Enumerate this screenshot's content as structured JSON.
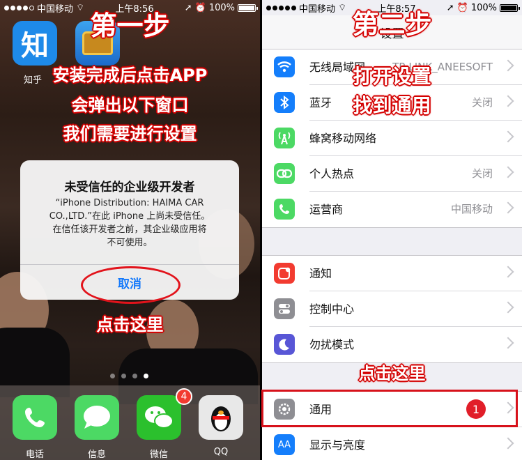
{
  "left": {
    "status": {
      "carrier": "中国移动",
      "time": "上午8:56",
      "battery": "100%"
    },
    "apps": [
      {
        "name": "知乎",
        "glyph": "知"
      }
    ],
    "overlay": {
      "step": "第一步",
      "line1": "安装完成后点击APP",
      "line2": "会弹出以下窗口",
      "line3": "我们需要进行设置",
      "click_here": "点击这里"
    },
    "alert": {
      "title": "未受信任的企业级开发者",
      "body_line1": "“iPhone Distribution: HAIMA CAR",
      "body_line2": "CO.,LTD.”在此 iPhone 上尚未受信任。",
      "body_line3": "在信任该开发者之前，其企业级应用将",
      "body_line4": "不可使用。",
      "cancel": "取消"
    },
    "dock": [
      {
        "label": "电话",
        "color": "#4cd964"
      },
      {
        "label": "信息",
        "color": "#4cd964"
      },
      {
        "label": "微信",
        "color": "#2bc02d",
        "badge": "4"
      },
      {
        "label": "QQ",
        "color": "#e8e8e8"
      }
    ]
  },
  "right": {
    "status": {
      "carrier": "中国移动",
      "time": "上午8:57",
      "battery": "100%"
    },
    "nav_title": "设置",
    "overlay": {
      "step": "第二步",
      "line1": "打开设置",
      "line2": "找到通用",
      "click_here": "点击这里"
    },
    "group1": [
      {
        "label": "无线局域网",
        "value": "TP-LINK_ANEESOFT",
        "icon": "wifi-icon",
        "color": "#147efb"
      },
      {
        "label": "蓝牙",
        "value": "关闭",
        "icon": "bluetooth-icon",
        "color": "#147efb"
      },
      {
        "label": "蜂窝移动网络",
        "value": "",
        "icon": "cellular-icon",
        "color": "#4cd964"
      },
      {
        "label": "个人热点",
        "value": "关闭",
        "icon": "hotspot-icon",
        "color": "#4cd964"
      },
      {
        "label": "运营商",
        "value": "中国移动",
        "icon": "phone-icon",
        "color": "#4cd964"
      }
    ],
    "group2": [
      {
        "label": "通知",
        "icon": "notifications-icon",
        "color": "#f23b30"
      },
      {
        "label": "控制中心",
        "icon": "control-center-icon",
        "color": "#8e8e93"
      },
      {
        "label": "勿扰模式",
        "icon": "moon-icon",
        "color": "#5856d6"
      }
    ],
    "group3": [
      {
        "label": "通用",
        "badge": "1",
        "icon": "gear-icon",
        "color": "#8e8e93"
      },
      {
        "label": "显示与亮度",
        "icon": "display-icon",
        "color": "#147efb",
        "glyph": "AA"
      }
    ]
  }
}
